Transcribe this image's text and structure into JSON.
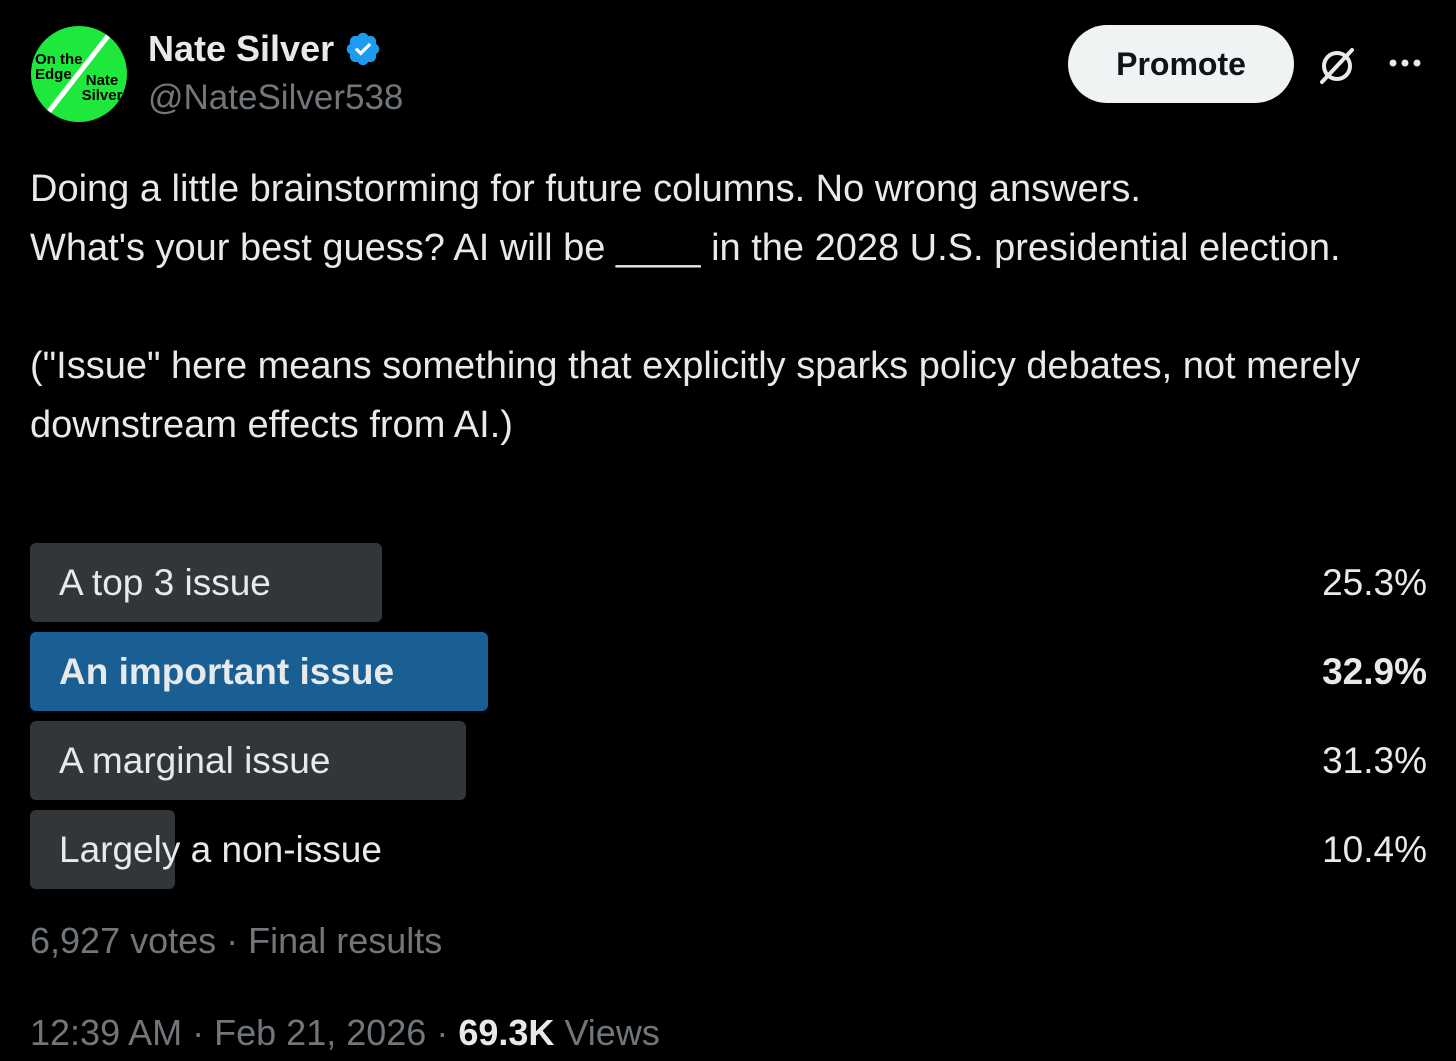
{
  "author": {
    "name": "Nate Silver",
    "handle": "@NateSilver538",
    "avatar_text_top": "On the Edge",
    "avatar_text_bottom": "Nate Silver",
    "verified_icon": "verified-badge-icon",
    "avatar_color": "#1ee83c"
  },
  "header": {
    "promote_label": "Promote",
    "grok_icon": "grok-icon",
    "more_icon": "more-icon"
  },
  "tweet": {
    "text": "Doing a little brainstorming for future columns. No wrong answers.\nWhat's your best guess? AI will be ____ in the 2028 U.S. presidential election.\n\n(\"Issue\" here means something that explicitly sparks policy debates, not merely downstream effects from AI.)"
  },
  "poll": {
    "options": [
      {
        "label": "A top 3 issue",
        "percent": "25.3%",
        "share": 0.253,
        "winner": false
      },
      {
        "label": "An important issue",
        "percent": "32.9%",
        "share": 0.329,
        "winner": true
      },
      {
        "label": "A marginal issue",
        "percent": "31.3%",
        "share": 0.313,
        "winner": false
      },
      {
        "label": "Largely a non-issue",
        "percent": "10.4%",
        "share": 0.104,
        "winner": false
      }
    ],
    "votes": "6,927 votes",
    "separator": "·",
    "status": "Final results",
    "bar_color": "#333639",
    "winner_color": "#1a5f93"
  },
  "meta": {
    "time": "12:39 AM",
    "date": "Feb 21, 2026",
    "views_count": "69.3K",
    "views_label": "Views",
    "separator": "·"
  }
}
